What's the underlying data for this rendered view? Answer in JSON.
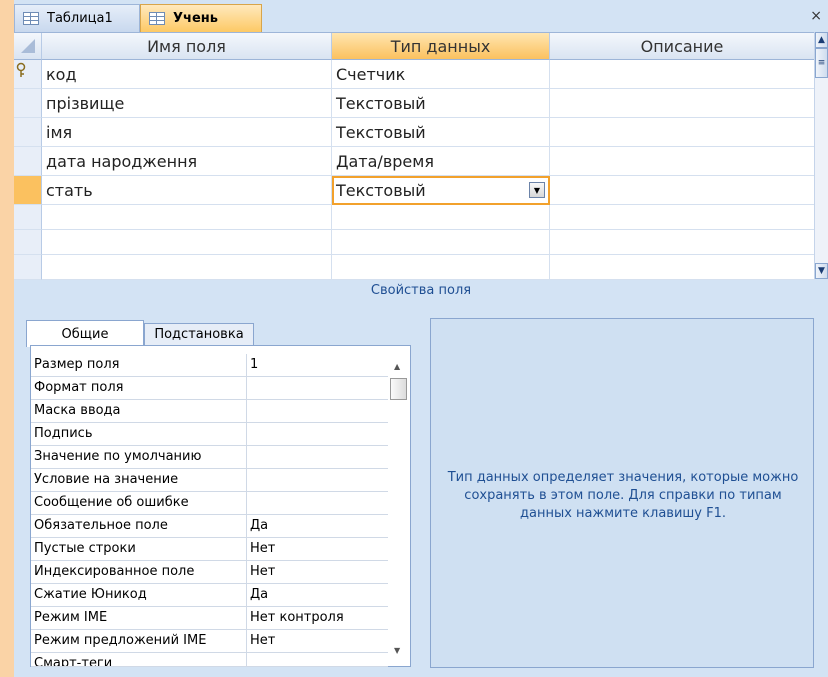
{
  "tabs": [
    {
      "label": "Таблица1",
      "active": false
    },
    {
      "label": "Учень",
      "active": true
    }
  ],
  "close_label": "×",
  "columns": [
    "Имя поля",
    "Тип данных",
    "Описание"
  ],
  "fields": [
    {
      "name": "код",
      "type": "Счетчик",
      "description": "",
      "primary_key": true
    },
    {
      "name": "прізвище",
      "type": "Текстовый",
      "description": ""
    },
    {
      "name": "імя",
      "type": "Текстовый",
      "description": ""
    },
    {
      "name": "дата народження",
      "type": "Дата/время",
      "description": ""
    },
    {
      "name": "стать",
      "type": "Текстовый",
      "description": "",
      "selected": true
    }
  ],
  "field_properties_label": "Свойства поля",
  "property_tabs": [
    "Общие",
    "Подстановка"
  ],
  "properties": [
    {
      "name": "Размер поля",
      "value": "1"
    },
    {
      "name": "Формат поля",
      "value": ""
    },
    {
      "name": "Маска ввода",
      "value": ""
    },
    {
      "name": "Подпись",
      "value": ""
    },
    {
      "name": "Значение по умолчанию",
      "value": ""
    },
    {
      "name": "Условие на значение",
      "value": ""
    },
    {
      "name": "Сообщение об ошибке",
      "value": ""
    },
    {
      "name": "Обязательное поле",
      "value": "Да"
    },
    {
      "name": "Пустые строки",
      "value": "Нет"
    },
    {
      "name": "Индексированное поле",
      "value": "Нет"
    },
    {
      "name": "Сжатие Юникод",
      "value": "Да"
    },
    {
      "name": "Режим IME",
      "value": "Нет контроля"
    },
    {
      "name": "Режим предложений IME",
      "value": "Нет"
    },
    {
      "name": "Смарт-теги",
      "value": ""
    }
  ],
  "help_text": "Тип данных определяет значения, которые можно сохранять в этом поле.  Для справки по типам данных нажмите клавишу F1.",
  "colors": {
    "accent": "#fbc15f",
    "window": "#d3e3f4",
    "background": "#fad3a6"
  },
  "icons": [
    "table-icon",
    "key-icon",
    "dropdown-arrow-icon",
    "scroll-up-icon",
    "scroll-down-icon"
  ]
}
